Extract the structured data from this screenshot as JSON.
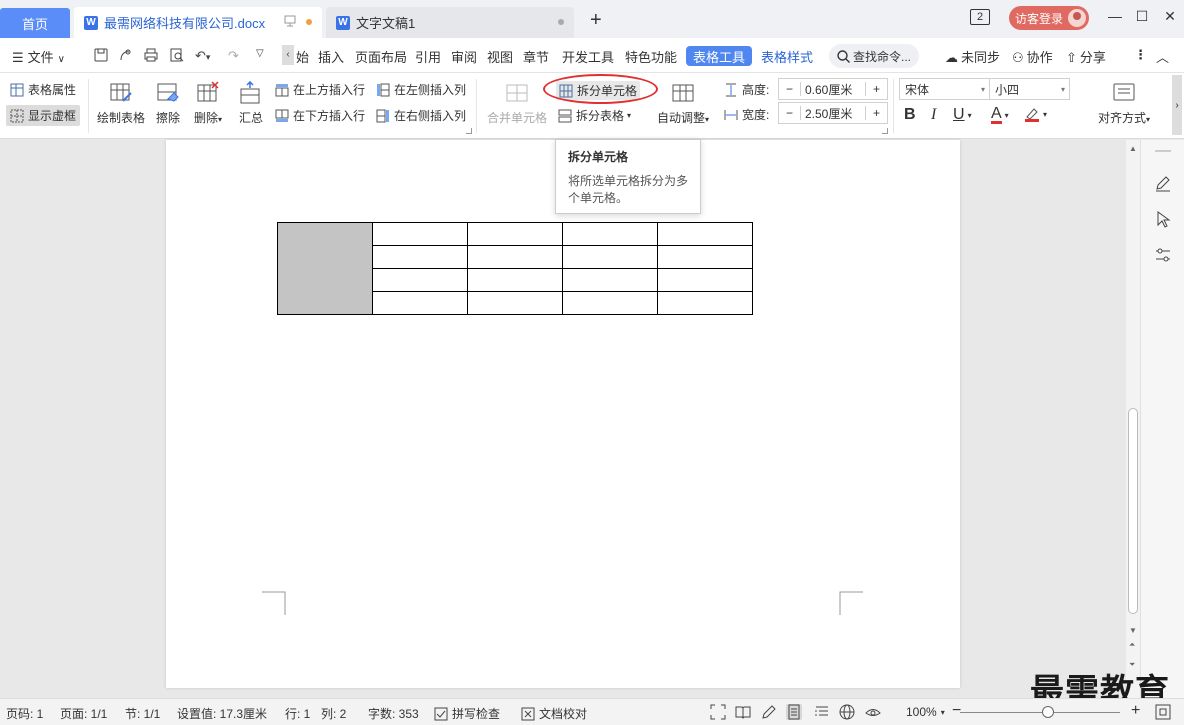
{
  "tabs": {
    "home": "首页",
    "doc1": "最需网络科技有限公司.docx",
    "doc2": "文字文稿1"
  },
  "titlebar": {
    "badge": "2",
    "login": "访客登录"
  },
  "menu": {
    "file": "文件",
    "items": [
      "始",
      "插入",
      "页面布局",
      "引用",
      "审阅",
      "视图",
      "章节",
      "开发工具",
      "特色功能"
    ],
    "active_tab": "表格工具",
    "table_style": "表格样式",
    "search": "查找命令...",
    "sync": "未同步",
    "collab": "协作",
    "share": "分享"
  },
  "ribbon": {
    "table_props": "表格属性",
    "show_grid": "显示虚框",
    "draw_table": "绘制表格",
    "erase": "擦除",
    "delete": "删除",
    "summary": "汇总",
    "insert_above": "在上方插入行",
    "insert_below": "在下方插入行",
    "insert_left": "在左侧插入列",
    "insert_right": "在右侧插入列",
    "merge_cells": "合并单元格",
    "split_cells": "拆分单元格",
    "split_table": "拆分表格",
    "auto_fit": "自动调整",
    "height_label": "高度:",
    "height_value": "0.60厘米",
    "width_label": "宽度:",
    "width_value": "2.50厘米",
    "font": "宋体",
    "font_size": "小四",
    "align": "对齐方式",
    "bold": "B",
    "italic": "I",
    "underline": "U",
    "font_color": "A"
  },
  "tooltip": {
    "title": "拆分单元格",
    "desc": "将所选单元格拆分为多个单元格。"
  },
  "status": {
    "page_num": "页码: 1",
    "pages": "页面: 1/1",
    "section": "节: 1/1",
    "setting": "设置值: 17.3厘米",
    "row": "行: 1",
    "col": "列: 2",
    "words": "字数: 353",
    "spell": "拼写检查",
    "proof": "文档校对",
    "zoom": "100%",
    "zoom_fraction": 0.55
  },
  "watermark": "最需教育",
  "colors": {
    "accent": "#4f86f0",
    "home_tab": "#5a8df7",
    "login": "#e06a61",
    "highlight": "#e03030",
    "merged_cell": "#c4c4c4"
  }
}
